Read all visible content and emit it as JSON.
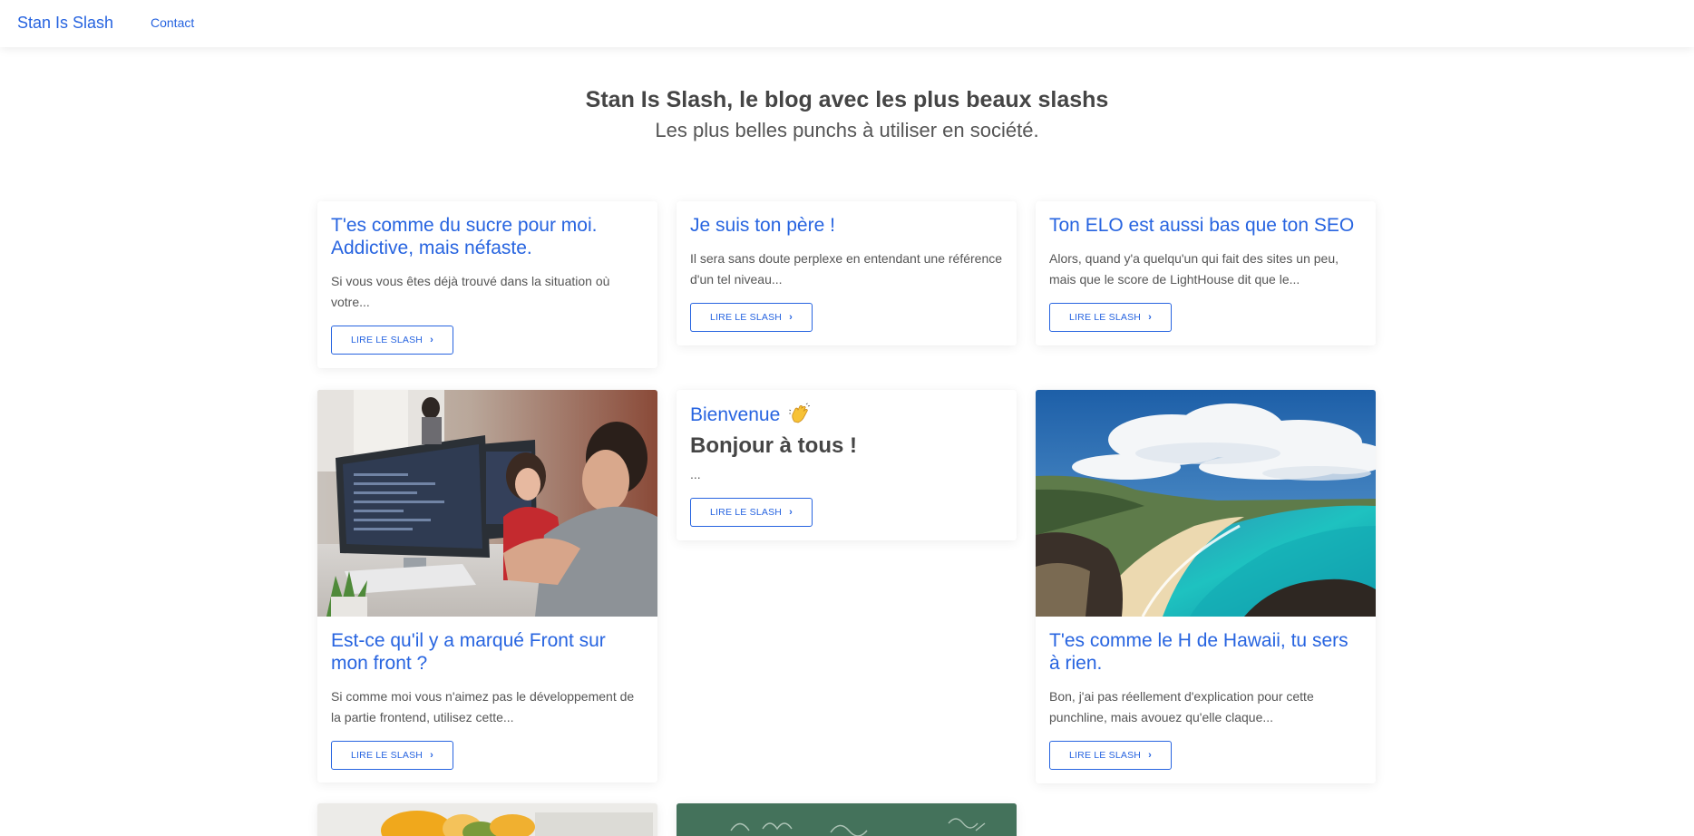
{
  "nav": {
    "brand": "Stan Is Slash",
    "contact": "Contact"
  },
  "hero": {
    "title": "Stan Is Slash, le blog avec les plus beaux slashs",
    "subtitle": "Les plus belles punchs à utiliser en société."
  },
  "button_label": "LIRE LE SLASH",
  "cards": [
    {
      "title": "T'es comme du sucre pour moi. Addictive, mais néfaste.",
      "excerpt": "Si vous vous êtes déjà trouvé dans la situation où votre..."
    },
    {
      "title": "Je suis ton père !",
      "excerpt": "Il sera sans doute perplexe en entendant une référence d'un tel niveau..."
    },
    {
      "title": "Ton ELO est aussi bas que ton SEO",
      "excerpt": "Alors, quand y'a quelqu'un qui fait des sites un peu, mais que le score de LightHouse dit que le..."
    },
    {
      "title": "Est-ce qu'il y a marqué Front sur mon front ?",
      "excerpt": "Si comme moi vous n'aimez pas le développement de la partie frontend, utilisez cette..."
    },
    {
      "title": "Bienvenue",
      "subtitle": "Bonjour à tous !",
      "excerpt": "..."
    },
    {
      "title": "T'es comme le H de Hawaii, tu sers à rien.",
      "excerpt": "Bon, j'ai pas réellement d'explication pour cette punchline, mais avouez qu'elle claque..."
    }
  ],
  "icons": {
    "button": "chevron-right-icon",
    "welcome": "waving-hand-icon"
  },
  "colors": {
    "accent": "#2764e0",
    "title": "#454545",
    "text": "#555555"
  }
}
